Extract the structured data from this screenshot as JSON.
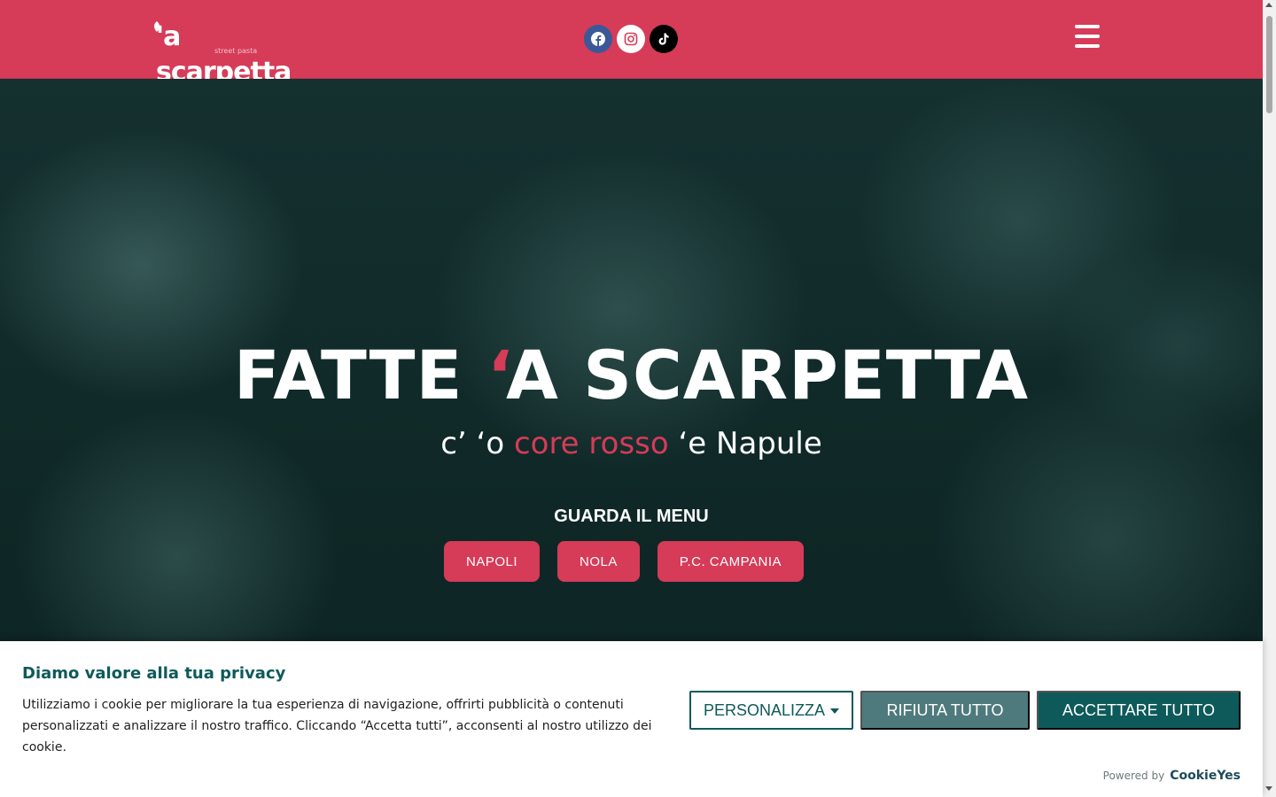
{
  "header": {
    "logo_text": "'a scarpetta",
    "logo_tagline": "street pasta",
    "socials": [
      {
        "name": "facebook",
        "icon": "facebook-icon"
      },
      {
        "name": "instagram",
        "icon": "instagram-icon"
      },
      {
        "name": "tiktok",
        "icon": "tiktok-icon"
      }
    ],
    "menu_icon": "hamburger-menu-icon"
  },
  "hero": {
    "title_part1": "FATTE ",
    "title_accent": "‘",
    "title_part2": "A SCARPETTA",
    "subtitle_part1": "c’ ‘o ",
    "subtitle_accent": "core rosso",
    "subtitle_part2": " ‘e Napule",
    "menu_heading": "GUARDA IL MENU",
    "city_buttons": [
      "NAPOLI",
      "NOLA",
      "P.C. CAMPANIA"
    ]
  },
  "cookie_banner": {
    "title": "Diamo valore alla tua privacy",
    "text": "Utilizziamo i cookie per migliorare la tua esperienza di navigazione, offrirti pubblicità o contenuti personalizzati e analizzare il nostro traffico. Cliccando “Accetta tutti”, acconsenti al nostro utilizzo dei cookie.",
    "customize_label": "PERSONALIZZA",
    "reject_label": "RIFIUTA TUTTO",
    "accept_label": "ACCETTARE TUTTO",
    "powered_by_label": "Powered by",
    "powered_by_brand": "CookieYes"
  },
  "colors": {
    "brand_red": "#d63b58",
    "cookie_teal": "#0e5a5a",
    "cookie_reject": "#4e7a7d"
  }
}
